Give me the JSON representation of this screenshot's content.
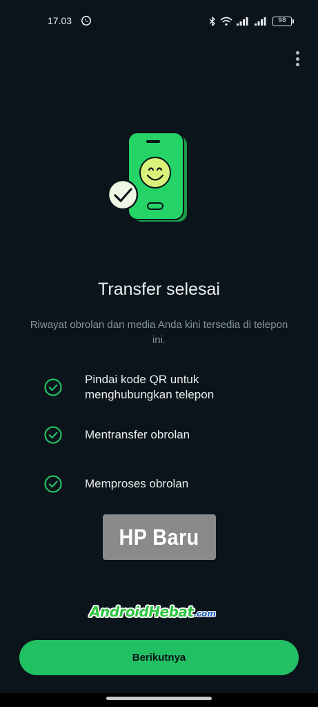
{
  "status_bar": {
    "time": "17.03",
    "battery": "98",
    "icons": [
      "whatsapp-icon",
      "bluetooth-icon",
      "wifi-icon",
      "signal-icon",
      "signal-icon",
      "battery-icon"
    ]
  },
  "header": {
    "menu_icon": "more-vert-icon"
  },
  "main": {
    "illustration_icon": "phone-smiley-check-icon",
    "title": "Transfer selesai",
    "subtitle": "Riwayat obrolan dan media Anda kini tersedia di telepon ini.",
    "steps": [
      {
        "label": "Pindai kode QR untuk menghubungkan telepon",
        "icon": "check-circle-icon"
      },
      {
        "label": "Mentransfer obrolan",
        "icon": "check-circle-icon"
      },
      {
        "label": "Memproses obrolan",
        "icon": "check-circle-icon"
      }
    ]
  },
  "overlays": {
    "label_box": "HP Baru",
    "brand_main": "AndroidHebat",
    "brand_tld": ".com"
  },
  "footer": {
    "next_label": "Berikutnya"
  },
  "colors": {
    "background": "#0b141a",
    "accent": "#21c063",
    "text_primary": "#e9edef",
    "text_secondary": "#8696a0"
  }
}
